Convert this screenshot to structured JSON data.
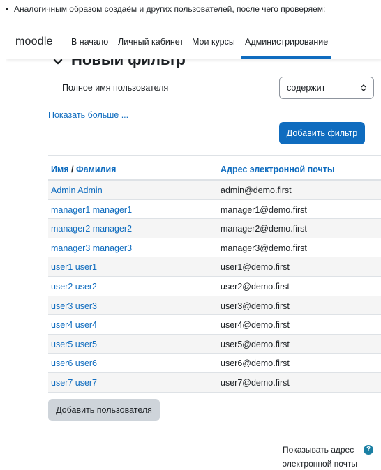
{
  "intro_text": "Аналогичным образом создаём и других пользователей, после чего проверяем:",
  "navbar": {
    "brand": "moodle",
    "items": [
      {
        "label": "В начало"
      },
      {
        "label": "Личный кабинет"
      },
      {
        "label": "Мои курсы"
      },
      {
        "label": "Администрирование",
        "active": true
      }
    ]
  },
  "filter": {
    "title": "Новый фильтр",
    "field_label": "Полное имя пользователя",
    "operator_value": "содержит",
    "show_more": "Показать больше ...",
    "add_filter_button": "Добавить фильтр"
  },
  "table": {
    "header_first": "Имя",
    "header_sep": " / ",
    "header_last": "Фамилия",
    "header_email": "Адрес электронной почты",
    "rows": [
      {
        "name": "Admin Admin",
        "email": "admin@demo.first"
      },
      {
        "name": "manager1 manager1",
        "email": "manager1@demo.first"
      },
      {
        "name": "manager2 manager2",
        "email": "manager2@demo.first"
      },
      {
        "name": "manager3 manager3",
        "email": "manager3@demo.first"
      },
      {
        "name": "user1 user1",
        "email": "user1@demo.first"
      },
      {
        "name": "user2 user2",
        "email": "user2@demo.first"
      },
      {
        "name": "user3 user3",
        "email": "user3@demo.first"
      },
      {
        "name": "user4 user4",
        "email": "user4@demo.first"
      },
      {
        "name": "user5 user5",
        "email": "user5@demo.first"
      },
      {
        "name": "user6 user6",
        "email": "user6@demo.first"
      },
      {
        "name": "user7 user7",
        "email": "user7@demo.first"
      }
    ]
  },
  "add_user_button": "Добавить пользователя",
  "bottom_setting": {
    "label_line1": "Показывать адрес",
    "label_line2": "электронной почты",
    "help_glyph": "?"
  },
  "colors": {
    "link": "#0f6cbf",
    "primary_button": "#0f6cbf",
    "secondary_button": "#ced4da",
    "help_icon": "#1a7fa3"
  }
}
